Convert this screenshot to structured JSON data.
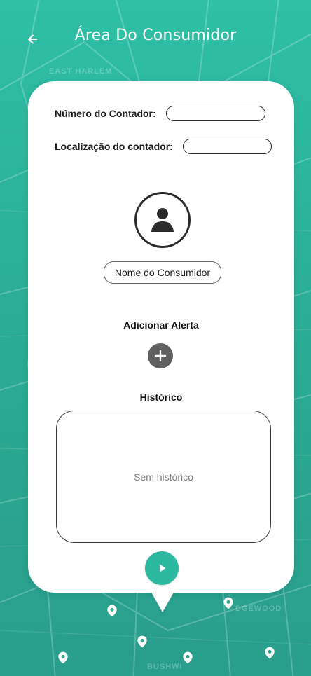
{
  "header": {
    "title": "Área Do Consumidor",
    "back_icon": "arrow-left-icon"
  },
  "form": {
    "meter_number_label": "Número do Contador:",
    "meter_number_value": "",
    "meter_location_label": "Localização do contador:",
    "meter_location_value": ""
  },
  "profile": {
    "avatar_icon": "user-avatar-icon",
    "consumer_name": "Nome do Consumidor"
  },
  "alerts": {
    "title": "Adicionar Alerta",
    "add_icon": "plus-circle-icon"
  },
  "history": {
    "title": "Histórico",
    "empty_text": "Sem histórico"
  },
  "actions": {
    "play_icon": "play-icon"
  },
  "map_labels": {
    "top": "EAST HARLEM",
    "bottom_left": "BUSHWI",
    "bottom_right": "DGEWOOD"
  },
  "colors": {
    "background": "#2bb19a",
    "card": "#ffffff",
    "accent": "#2bb9a0",
    "add_button": "#5f5f5f"
  }
}
